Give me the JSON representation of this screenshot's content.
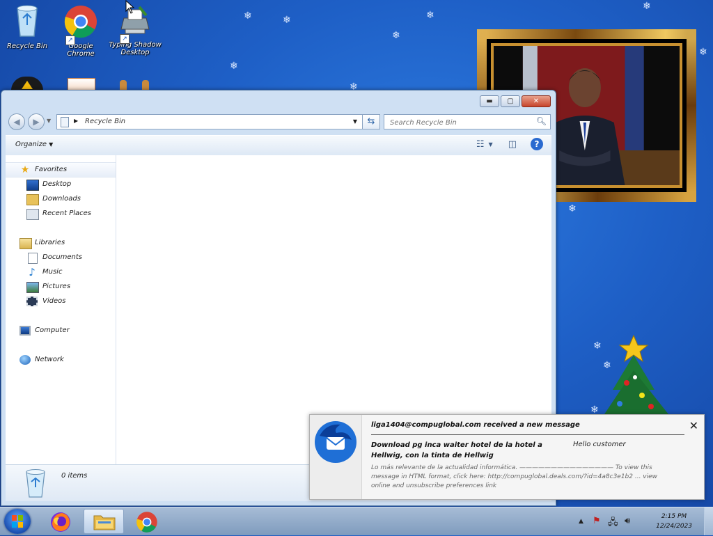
{
  "desktop": {
    "icons": [
      {
        "label": "Recycle Bin"
      },
      {
        "label": "Google Chrome"
      },
      {
        "label": "Typing Shadow Desktop"
      }
    ]
  },
  "explorer": {
    "address_path": "Recycle Bin",
    "search_placeholder": "Search Recycle Bin",
    "organize_label": "Organize",
    "nav": {
      "favorites": "Favorites",
      "desktop": "Desktop",
      "downloads": "Downloads",
      "recent": "Recent Places",
      "libraries": "Libraries",
      "documents": "Documents",
      "music": "Music",
      "pictures": "Pictures",
      "videos": "Videos",
      "computer": "Computer",
      "network": "Network"
    },
    "item_count": "0 items"
  },
  "toast": {
    "title": "liga1404@compuglobal.com received a new message",
    "subject": "Download pg inca waiter hotel de la hotel a Hellwig, con la tinta de Hellwig",
    "sender": "Hello customer",
    "body": "Lo más relevante de la actualidad informática. ——————————————— To view this message in HTML format, click here: http://compuglobal.deals.com/?id=4a8c3e1b2 ... view online and unsubscribe preferences link"
  },
  "tray": {
    "time": "2:15 PM",
    "date": "12/24/2023"
  },
  "colors": {
    "desktop_bg": "#1e5fc6",
    "window_frame": "#cfe0f3",
    "close_button": "#c7442b"
  }
}
